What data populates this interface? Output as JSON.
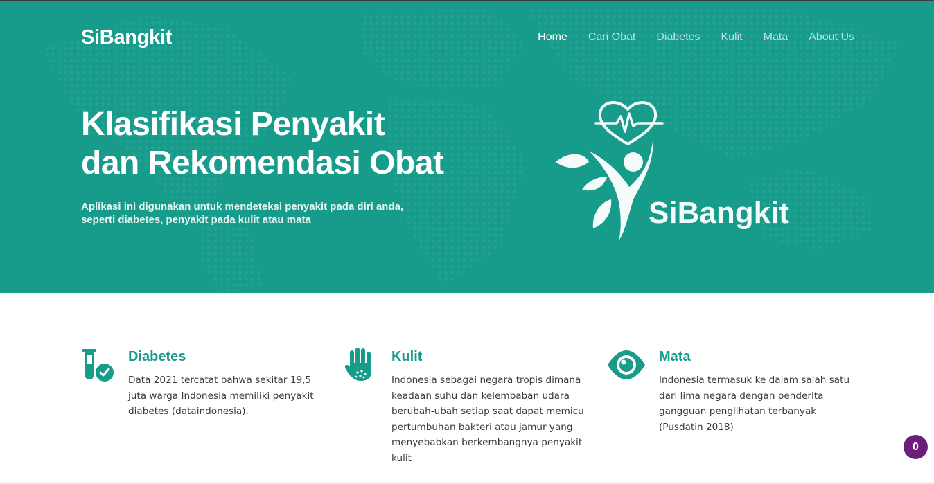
{
  "brand": "SiBangkit",
  "nav": [
    "Home",
    "Cari Obat",
    "Diabetes",
    "Kulit",
    "Mata",
    "About Us"
  ],
  "hero": {
    "title_lines": [
      "Klasifikasi Penyakit",
      "dan Rekomendasi Obat"
    ],
    "subtitle_lines": [
      "Aplikasi ini digunakan untuk mendeteksi penyakit pada diri anda,",
      "seperti diabetes, penyakit pada kulit atau mata"
    ],
    "logo_text": "SiBangkit"
  },
  "features": [
    {
      "icon": "test-tube-check-icon",
      "title": "Diabetes",
      "lines": [
        "Data 2021 tercatat bahwa sekitar 19,5",
        "juta warga Indonesia memiliki penyakit",
        "diabetes (dataindonesia)."
      ]
    },
    {
      "icon": "hand-icon",
      "title": "Kulit",
      "lines": [
        "Indonesia sebagai negara tropis dimana",
        "keadaan suhu dan kelembaban udara",
        "berubah-ubah setiap saat dapat memicu",
        "pertumbuhan bakteri atau jamur yang",
        "menyebabkan berkembangnya penyakit",
        "kulit"
      ]
    },
    {
      "icon": "eye-icon",
      "title": "Mata",
      "lines": [
        "Indonesia termasuk ke dalam salah satu",
        "dari lima negara dengan penderita",
        "gangguan penglihatan terbanyak",
        "(Pusdatin 2018)"
      ]
    }
  ],
  "badge_count": "0",
  "colors": {
    "primary": "#179b8b",
    "badge": "#6b1f7a",
    "white": "#ffffff"
  }
}
